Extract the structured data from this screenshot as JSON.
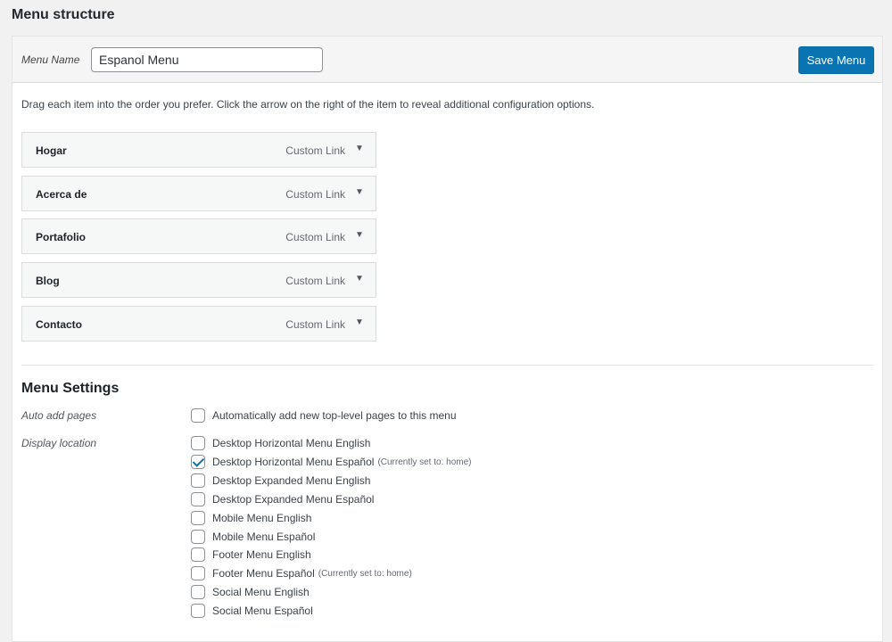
{
  "page": {
    "heading": "Menu structure"
  },
  "header": {
    "menu_name_label": "Menu Name",
    "menu_name_value": "Espanol Menu",
    "save_label": "Save Menu"
  },
  "instructions": "Drag each item into the order you prefer. Click the arrow on the right of the item to reveal additional configuration options.",
  "menu_items": [
    {
      "title": "Hogar",
      "type": "Custom Link",
      "arrow": "▼"
    },
    {
      "title": "Acerca de",
      "type": "Custom Link",
      "arrow": "▼"
    },
    {
      "title": "Portafolio",
      "type": "Custom Link",
      "arrow": "▼"
    },
    {
      "title": "Blog",
      "type": "Custom Link",
      "arrow": "▼"
    },
    {
      "title": "Contacto",
      "type": "Custom Link",
      "arrow": "▼"
    }
  ],
  "settings": {
    "title": "Menu Settings",
    "auto_add_label": "Auto add pages",
    "auto_add_option": {
      "label": "Automatically add new top-level pages to this menu",
      "checked": false
    },
    "display_location_label": "Display location",
    "locations": [
      {
        "label": "Desktop Horizontal Menu English",
        "note": "",
        "checked": false
      },
      {
        "label": "Desktop Horizontal Menu Español",
        "note": "(Currently set to: home)",
        "checked": true
      },
      {
        "label": "Desktop Expanded Menu English",
        "note": "",
        "checked": false
      },
      {
        "label": "Desktop Expanded Menu Español",
        "note": "",
        "checked": false
      },
      {
        "label": "Mobile Menu English",
        "note": "",
        "checked": false
      },
      {
        "label": "Mobile Menu Español",
        "note": "",
        "checked": false
      },
      {
        "label": "Footer Menu English",
        "note": "",
        "checked": false
      },
      {
        "label": "Footer Menu Español",
        "note": "(Currently set to: home)",
        "checked": false
      },
      {
        "label": "Social Menu English",
        "note": "",
        "checked": false
      },
      {
        "label": "Social Menu Español",
        "note": "",
        "checked": false
      }
    ]
  },
  "colors": {
    "primary": "#0a73b1",
    "background": "#f1f1f1",
    "panel": "#ffffff"
  }
}
